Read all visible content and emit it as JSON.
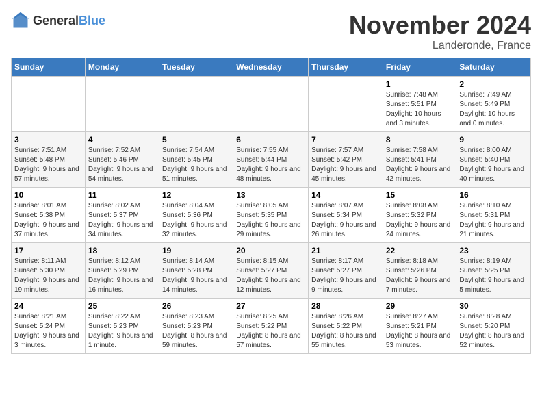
{
  "header": {
    "logo_general": "General",
    "logo_blue": "Blue",
    "month_title": "November 2024",
    "location": "Landeronde, France"
  },
  "weekdays": [
    "Sunday",
    "Monday",
    "Tuesday",
    "Wednesday",
    "Thursday",
    "Friday",
    "Saturday"
  ],
  "weeks": [
    [
      {
        "day": "",
        "detail": ""
      },
      {
        "day": "",
        "detail": ""
      },
      {
        "day": "",
        "detail": ""
      },
      {
        "day": "",
        "detail": ""
      },
      {
        "day": "",
        "detail": ""
      },
      {
        "day": "1",
        "detail": "Sunrise: 7:48 AM\nSunset: 5:51 PM\nDaylight: 10 hours and 3 minutes."
      },
      {
        "day": "2",
        "detail": "Sunrise: 7:49 AM\nSunset: 5:49 PM\nDaylight: 10 hours and 0 minutes."
      }
    ],
    [
      {
        "day": "3",
        "detail": "Sunrise: 7:51 AM\nSunset: 5:48 PM\nDaylight: 9 hours and 57 minutes."
      },
      {
        "day": "4",
        "detail": "Sunrise: 7:52 AM\nSunset: 5:46 PM\nDaylight: 9 hours and 54 minutes."
      },
      {
        "day": "5",
        "detail": "Sunrise: 7:54 AM\nSunset: 5:45 PM\nDaylight: 9 hours and 51 minutes."
      },
      {
        "day": "6",
        "detail": "Sunrise: 7:55 AM\nSunset: 5:44 PM\nDaylight: 9 hours and 48 minutes."
      },
      {
        "day": "7",
        "detail": "Sunrise: 7:57 AM\nSunset: 5:42 PM\nDaylight: 9 hours and 45 minutes."
      },
      {
        "day": "8",
        "detail": "Sunrise: 7:58 AM\nSunset: 5:41 PM\nDaylight: 9 hours and 42 minutes."
      },
      {
        "day": "9",
        "detail": "Sunrise: 8:00 AM\nSunset: 5:40 PM\nDaylight: 9 hours and 40 minutes."
      }
    ],
    [
      {
        "day": "10",
        "detail": "Sunrise: 8:01 AM\nSunset: 5:38 PM\nDaylight: 9 hours and 37 minutes."
      },
      {
        "day": "11",
        "detail": "Sunrise: 8:02 AM\nSunset: 5:37 PM\nDaylight: 9 hours and 34 minutes."
      },
      {
        "day": "12",
        "detail": "Sunrise: 8:04 AM\nSunset: 5:36 PM\nDaylight: 9 hours and 32 minutes."
      },
      {
        "day": "13",
        "detail": "Sunrise: 8:05 AM\nSunset: 5:35 PM\nDaylight: 9 hours and 29 minutes."
      },
      {
        "day": "14",
        "detail": "Sunrise: 8:07 AM\nSunset: 5:34 PM\nDaylight: 9 hours and 26 minutes."
      },
      {
        "day": "15",
        "detail": "Sunrise: 8:08 AM\nSunset: 5:32 PM\nDaylight: 9 hours and 24 minutes."
      },
      {
        "day": "16",
        "detail": "Sunrise: 8:10 AM\nSunset: 5:31 PM\nDaylight: 9 hours and 21 minutes."
      }
    ],
    [
      {
        "day": "17",
        "detail": "Sunrise: 8:11 AM\nSunset: 5:30 PM\nDaylight: 9 hours and 19 minutes."
      },
      {
        "day": "18",
        "detail": "Sunrise: 8:12 AM\nSunset: 5:29 PM\nDaylight: 9 hours and 16 minutes."
      },
      {
        "day": "19",
        "detail": "Sunrise: 8:14 AM\nSunset: 5:28 PM\nDaylight: 9 hours and 14 minutes."
      },
      {
        "day": "20",
        "detail": "Sunrise: 8:15 AM\nSunset: 5:27 PM\nDaylight: 9 hours and 12 minutes."
      },
      {
        "day": "21",
        "detail": "Sunrise: 8:17 AM\nSunset: 5:27 PM\nDaylight: 9 hours and 9 minutes."
      },
      {
        "day": "22",
        "detail": "Sunrise: 8:18 AM\nSunset: 5:26 PM\nDaylight: 9 hours and 7 minutes."
      },
      {
        "day": "23",
        "detail": "Sunrise: 8:19 AM\nSunset: 5:25 PM\nDaylight: 9 hours and 5 minutes."
      }
    ],
    [
      {
        "day": "24",
        "detail": "Sunrise: 8:21 AM\nSunset: 5:24 PM\nDaylight: 9 hours and 3 minutes."
      },
      {
        "day": "25",
        "detail": "Sunrise: 8:22 AM\nSunset: 5:23 PM\nDaylight: 9 hours and 1 minute."
      },
      {
        "day": "26",
        "detail": "Sunrise: 8:23 AM\nSunset: 5:23 PM\nDaylight: 8 hours and 59 minutes."
      },
      {
        "day": "27",
        "detail": "Sunrise: 8:25 AM\nSunset: 5:22 PM\nDaylight: 8 hours and 57 minutes."
      },
      {
        "day": "28",
        "detail": "Sunrise: 8:26 AM\nSunset: 5:22 PM\nDaylight: 8 hours and 55 minutes."
      },
      {
        "day": "29",
        "detail": "Sunrise: 8:27 AM\nSunset: 5:21 PM\nDaylight: 8 hours and 53 minutes."
      },
      {
        "day": "30",
        "detail": "Sunrise: 8:28 AM\nSunset: 5:20 PM\nDaylight: 8 hours and 52 minutes."
      }
    ]
  ]
}
